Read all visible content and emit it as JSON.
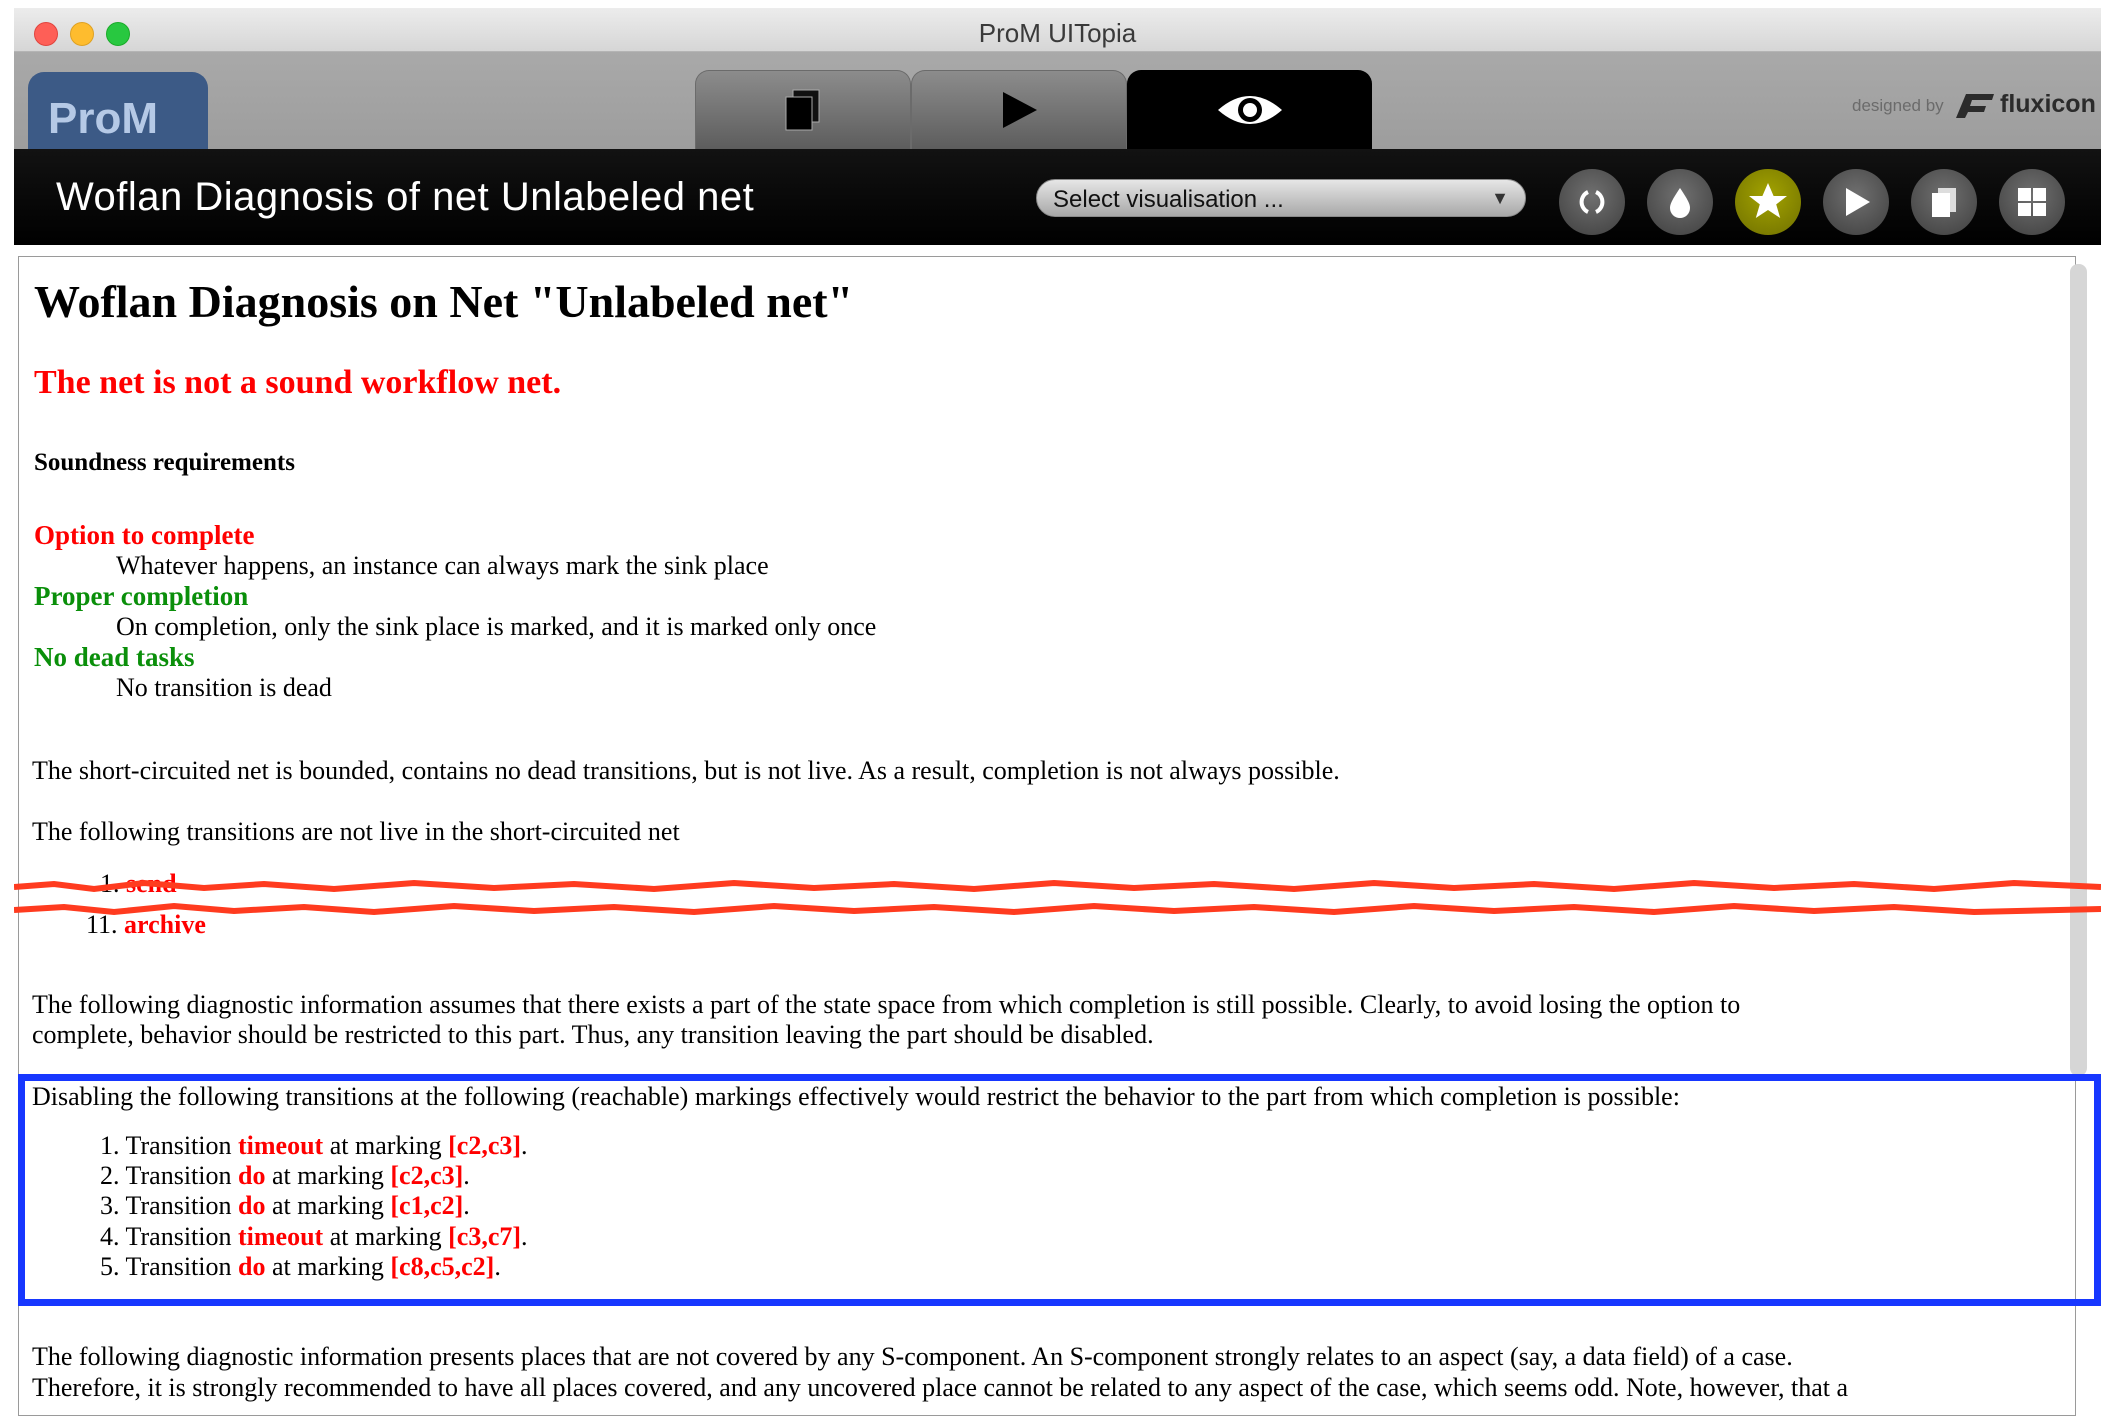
{
  "window": {
    "title": "ProM UITopia"
  },
  "tabbar": {
    "logo_text": "ProM",
    "tabs": [
      {
        "name": "workspace",
        "icon": "copy-icon"
      },
      {
        "name": "actions",
        "icon": "play-icon"
      },
      {
        "name": "views",
        "icon": "eye-icon",
        "active": true
      }
    ],
    "designed_by": "designed by",
    "brand": "fluxicon"
  },
  "view_header": {
    "title": "Woflan Diagnosis of net Unlabeled net",
    "select_placeholder": "Select visualisation ...",
    "buttons": [
      "refresh-icon",
      "drop-icon",
      "star-icon",
      "play-icon",
      "copy-icon",
      "grid-icon"
    ],
    "accent_color": "#8f8f00"
  },
  "report": {
    "title": "Woflan Diagnosis on Net \"Unlabeled net\"",
    "verdict": "The net is not a sound workflow net.",
    "soundness_heading": "Soundness requirements",
    "requirements": [
      {
        "name": "Option to complete",
        "status_color": "#ff0000",
        "description": "Whatever happens, an instance can always mark the sink place"
      },
      {
        "name": "Proper completion",
        "status_color": "#0a8f0a",
        "description": "On completion, only the sink place is marked, and it is marked only once"
      },
      {
        "name": "No dead tasks",
        "status_color": "#0a8f0a",
        "description": "No transition is dead"
      }
    ],
    "para_bounded": "The short-circuited net is bounded, contains no dead transitions, but is not live. As a result, completion is not always possible.",
    "para_not_live": "The following transitions are not live in the short-circuited net",
    "not_live_items": [
      {
        "num": "1.",
        "name": "send"
      },
      {
        "num": "11.",
        "name": "archive"
      }
    ],
    "para_diag_1": "The following diagnostic information assumes that there exists a part of the state space from which completion is still possible. Clearly, to avoid losing the option to",
    "para_diag_2": "complete, behavior should be restricted to this part. Thus, any transition leaving the part should be disabled.",
    "para_disable": "Disabling the following transitions at the following (reachable) markings effectively would restrict the behavior to the part from which completion is possible:",
    "disable_items": [
      {
        "num": "1.",
        "prefix": "Transition",
        "transition": "timeout",
        "mid": "at marking",
        "marking": "[c2,c3]",
        "end": "."
      },
      {
        "num": "2.",
        "prefix": "Transition",
        "transition": "do",
        "mid": "at marking",
        "marking": "[c2,c3]",
        "end": "."
      },
      {
        "num": "3.",
        "prefix": "Transition",
        "transition": "do",
        "mid": "at marking",
        "marking": "[c1,c2]",
        "end": "."
      },
      {
        "num": "4.",
        "prefix": "Transition",
        "transition": "timeout",
        "mid": "at marking",
        "marking": "[c3,c7]",
        "end": "."
      },
      {
        "num": "5.",
        "prefix": "Transition",
        "transition": "do",
        "mid": "at marking",
        "marking": "[c8,c5,c2]",
        "end": "."
      }
    ],
    "para_scomp_1": "The following diagnostic information presents places that are not covered by any S-component. An S-component strongly relates to an aspect (say, a data field) of a case.",
    "para_scomp_2": "Therefore, it is strongly recommended to have all places covered, and any uncovered place cannot be related to any aspect of the case, which seems odd. Note, however, that a"
  },
  "annotations": {
    "highlight_color": "#1737ff",
    "tear_color": "#ff3b1f"
  }
}
